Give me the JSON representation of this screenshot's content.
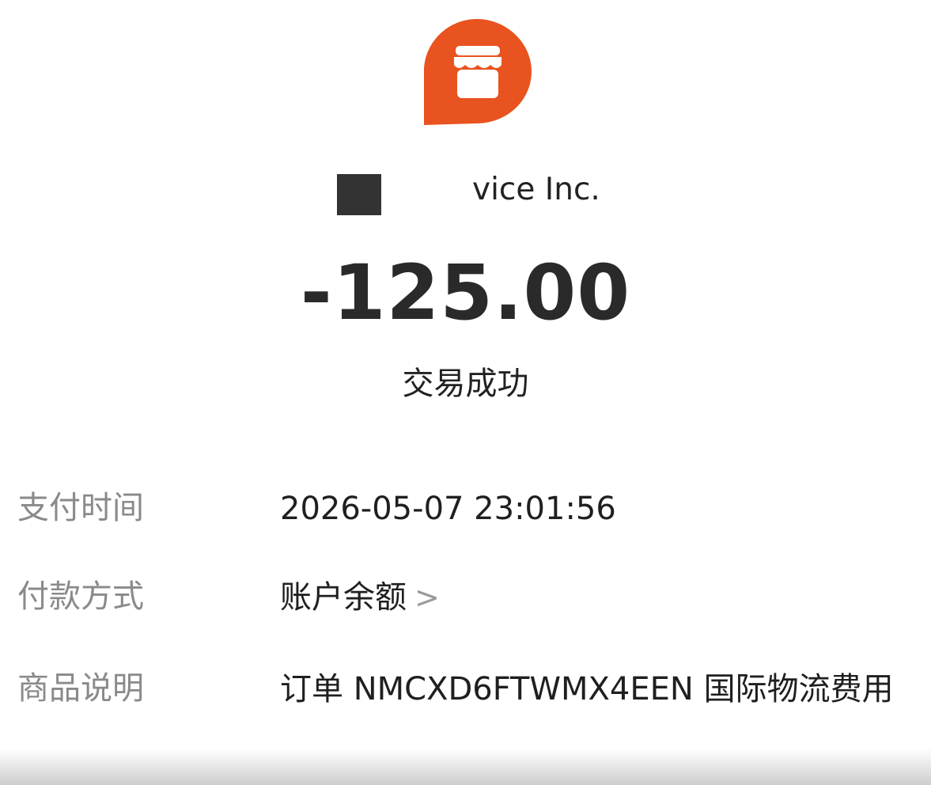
{
  "merchant": {
    "logo_icon": "shop-storefront-icon",
    "logo_color": "#E8531F",
    "name_visible": "vice Inc."
  },
  "transaction": {
    "amount": "-125.00",
    "status": "交易成功"
  },
  "details": {
    "pay_time": {
      "label": "支付时间",
      "value": "2026-05-07 23:01:56"
    },
    "pay_method": {
      "label": "付款方式",
      "value": "账户余额",
      "chevron": ">"
    },
    "description": {
      "label": "商品说明",
      "value": "订单 NMCXD6FTWMX4EEN 国际物流费用"
    }
  }
}
